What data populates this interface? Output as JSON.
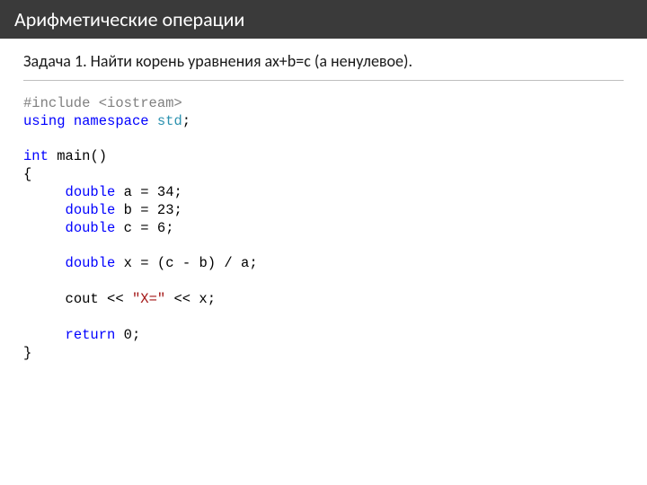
{
  "title": "Арифметические операции",
  "problem": "Задача 1. Найти корень уравнения ax+b=c  (a ненулевое).",
  "code": {
    "pp_include": "#include",
    "pp_header": " <iostream>",
    "kw_using": "using",
    "kw_namespace": "namespace",
    "ns_std": "std",
    "semi": ";",
    "kw_int": "int",
    "fn_main": "main",
    "paren_open": "(",
    "paren_close": ")",
    "brace_open": "{",
    "brace_close": "}",
    "kw_double": "double",
    "var_a": "a",
    "var_b": "b",
    "var_c": "c",
    "var_x": "x",
    "op_eq": "=",
    "lit_34": "34",
    "lit_23": "23",
    "lit_6": "6",
    "op_minus": "-",
    "op_div": "/",
    "id_cout": "cout",
    "op_ins": "<<",
    "str_xeq": "\"X=\"",
    "kw_return": "return",
    "lit_0": "0",
    "indent1": "     ",
    "indent0": ""
  }
}
